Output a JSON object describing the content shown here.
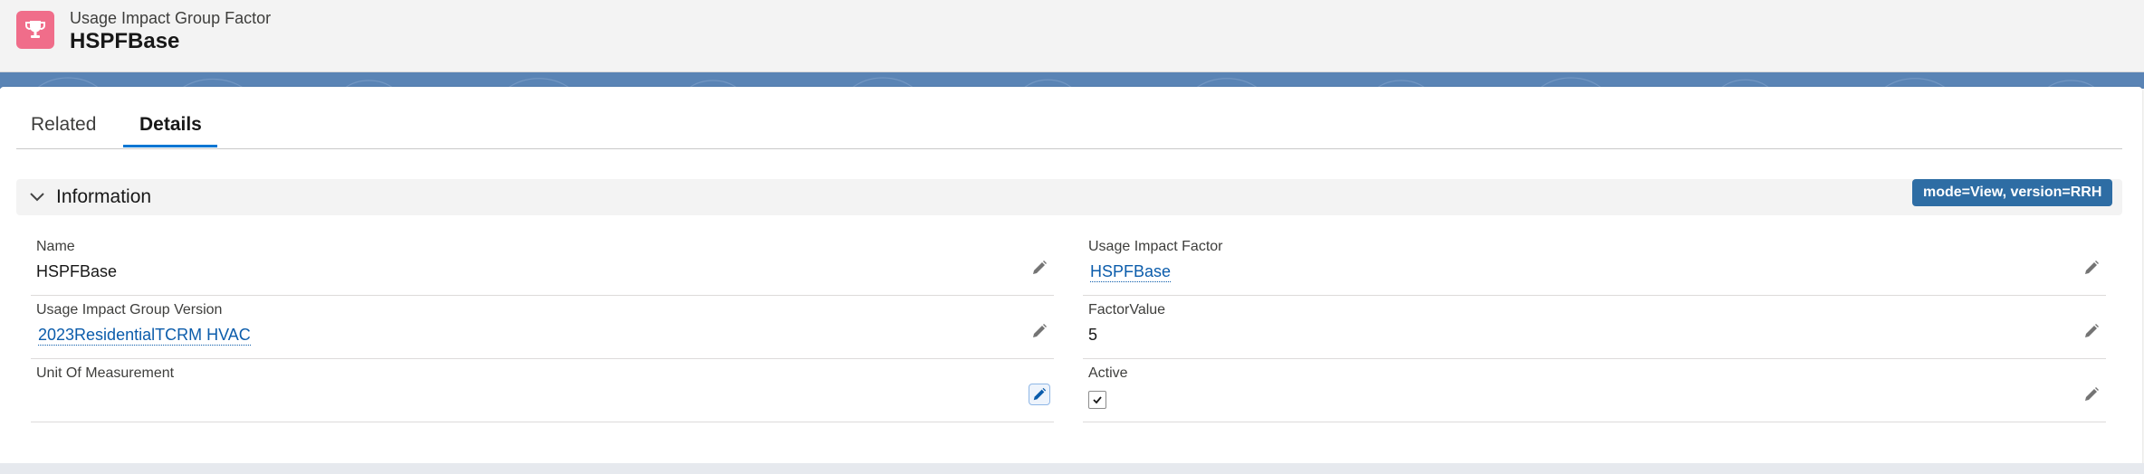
{
  "header": {
    "object_type": "Usage Impact Group Factor",
    "record_name": "HSPFBase",
    "icon": "trophy-icon",
    "icon_color": "#f06d8a"
  },
  "tabs": [
    {
      "label": "Related",
      "active": false
    },
    {
      "label": "Details",
      "active": true
    }
  ],
  "section": {
    "title": "Information",
    "expanded": true,
    "badge": "mode=View, version=RRH"
  },
  "fields": {
    "name": {
      "label": "Name",
      "value": "HSPFBase"
    },
    "usage_impact_group_version": {
      "label": "Usage Impact Group Version",
      "value": "2023ResidentialTCRM HVAC"
    },
    "unit_of_measurement": {
      "label": "Unit Of Measurement",
      "value": ""
    },
    "usage_impact_factor": {
      "label": "Usage Impact Factor",
      "value": "HSPFBase"
    },
    "factor_value": {
      "label": "FactorValue",
      "value": "5"
    },
    "active": {
      "label": "Active",
      "checked": true
    }
  },
  "colors": {
    "accent": "#0176d3",
    "link": "#0b5cab",
    "badge_bg": "#2e6da4",
    "banner": "#5a84b5"
  }
}
